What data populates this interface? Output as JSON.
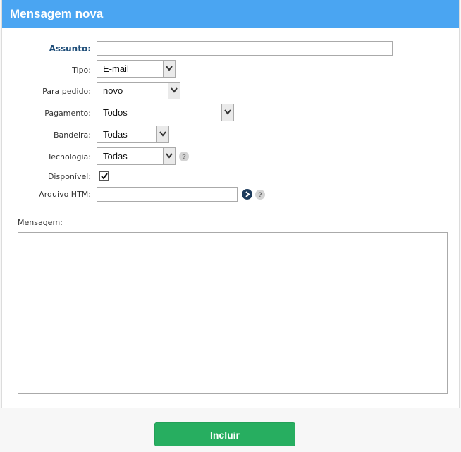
{
  "header": {
    "title": "Mensagem nova"
  },
  "form": {
    "assunto": {
      "label": "Assunto:",
      "value": ""
    },
    "tipo": {
      "label": "Tipo:",
      "value": "E-mail"
    },
    "para_pedido": {
      "label": "Para pedido:",
      "value": "novo"
    },
    "pagamento": {
      "label": "Pagamento:",
      "value": "Todos"
    },
    "bandeira": {
      "label": "Bandeira:",
      "value": "Todas"
    },
    "tecnologia": {
      "label": "Tecnologia:",
      "value": "Todas",
      "help": "?"
    },
    "disponivel": {
      "label": "Disponível:",
      "checked": true
    },
    "arquivo_htm": {
      "label": "Arquivo HTM:",
      "value": "",
      "help": "?"
    },
    "mensagem": {
      "label": "Mensagem:",
      "value": ""
    }
  },
  "actions": {
    "submit_label": "Incluir"
  },
  "colors": {
    "header": "#4aa5f2",
    "button": "#27ae60",
    "go_icon": "#1d3b5c"
  }
}
